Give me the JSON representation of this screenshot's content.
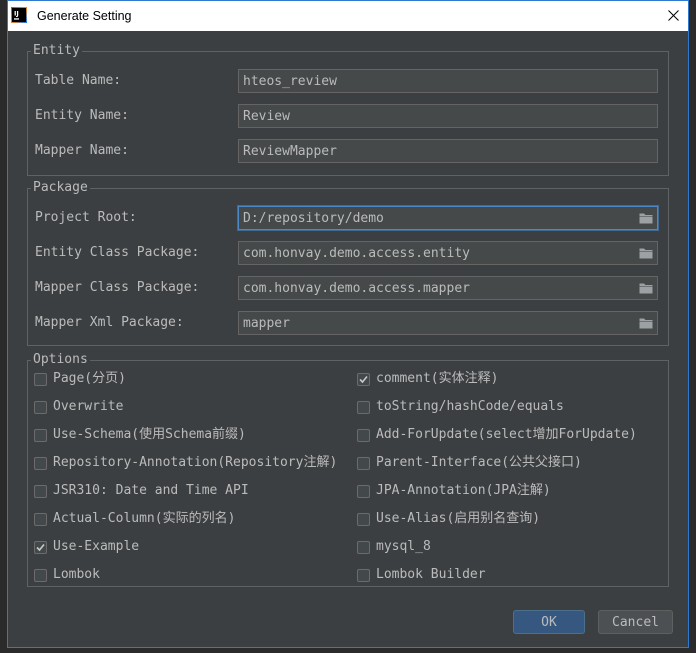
{
  "window": {
    "title": "Generate Setting",
    "logo": "IJ"
  },
  "entity": {
    "title": "Entity",
    "fields": [
      {
        "label": "Table Name:",
        "value": "hteos_review"
      },
      {
        "label": "Entity Name:",
        "value": "Review"
      },
      {
        "label": "Mapper Name:",
        "value": "ReviewMapper"
      }
    ]
  },
  "package": {
    "title": "Package",
    "fields": [
      {
        "label": "Project Root:",
        "value": "D:/repository/demo",
        "focused": true,
        "icon": "folder-icon"
      },
      {
        "label": "Entity Class Package:",
        "value": "com.honvay.demo.access.entity",
        "icon": "folder-icon"
      },
      {
        "label": "Mapper Class Package:",
        "value": "com.honvay.demo.access.mapper",
        "icon": "folder-icon"
      },
      {
        "label": "Mapper Xml Package:",
        "value": "mapper",
        "icon": "folder-icon"
      }
    ]
  },
  "options": {
    "title": "Options",
    "left": [
      {
        "label": "Page(分页)",
        "checked": false
      },
      {
        "label": "Overwrite",
        "checked": false
      },
      {
        "label": "Use-Schema(使用Schema前缀)",
        "checked": false
      },
      {
        "label": "Repository-Annotation(Repository注解)",
        "checked": false
      },
      {
        "label": "JSR310: Date and Time API",
        "checked": false
      },
      {
        "label": "Actual-Column(实际的列名)",
        "checked": false
      },
      {
        "label": "Use-Example",
        "checked": true
      },
      {
        "label": "Lombok",
        "checked": false
      }
    ],
    "right": [
      {
        "label": "comment(实体注释)",
        "checked": true
      },
      {
        "label": "toString/hashCode/equals",
        "checked": false
      },
      {
        "label": "Add-ForUpdate(select增加ForUpdate)",
        "checked": false
      },
      {
        "label": "Parent-Interface(公共父接口)",
        "checked": false
      },
      {
        "label": "JPA-Annotation(JPA注解)",
        "checked": false
      },
      {
        "label": "Use-Alias(启用别名查询)",
        "checked": false
      },
      {
        "label": "mysql_8",
        "checked": false
      },
      {
        "label": "Lombok Builder",
        "checked": false
      }
    ]
  },
  "buttons": {
    "ok": "OK",
    "cancel": "Cancel"
  },
  "icons": {
    "logo": "intellij-logo-icon",
    "close": "close-icon",
    "folder": "folder-icon",
    "check": "checkmark-icon"
  },
  "colors": {
    "outer_bg": "#2b2b2b",
    "dialog_bg": "#3c3f41",
    "title_bar_bg": "#ffffff",
    "title_text": "#000000",
    "window_border": "#2f79d0",
    "text": "#bbbbbb",
    "group_border": "#5f6264",
    "field_bg": "#45494a",
    "field_border": "#646464",
    "focus_border": "#4a88c7",
    "focus_ring": "#3f6a96",
    "checkbox_bg": "#43494a",
    "checkbox_border": "#6b6b6b",
    "ok_button_bg": "#365880",
    "ok_button_border": "#4c708c",
    "cancel_button_bg": "#4c5052",
    "cancel_button_border": "#5e6060"
  }
}
